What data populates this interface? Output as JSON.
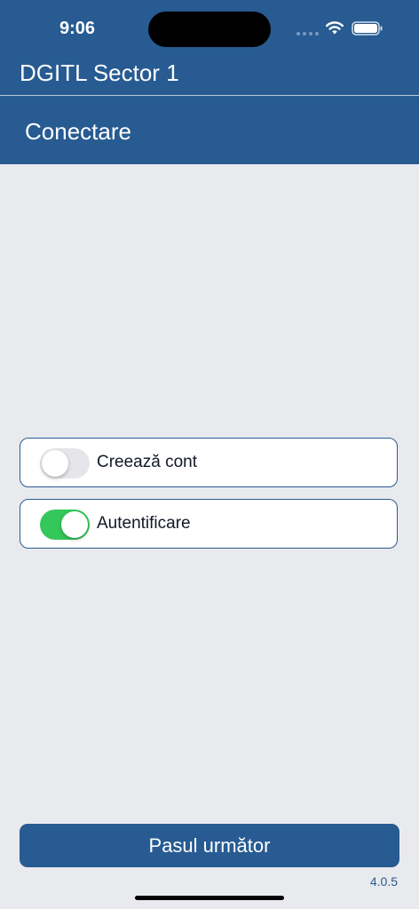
{
  "status_bar": {
    "time": "9:06"
  },
  "header": {
    "app_title": "DGITL Sector 1",
    "page_title": "Conectare"
  },
  "options": [
    {
      "label": "Creează cont",
      "enabled": false
    },
    {
      "label": "Autentificare",
      "enabled": true
    }
  ],
  "footer": {
    "next_label": "Pasul următor",
    "version": "4.0.5"
  },
  "colors": {
    "header": "#275b92",
    "toggle_on": "#34c759",
    "background": "#e9eaee"
  }
}
